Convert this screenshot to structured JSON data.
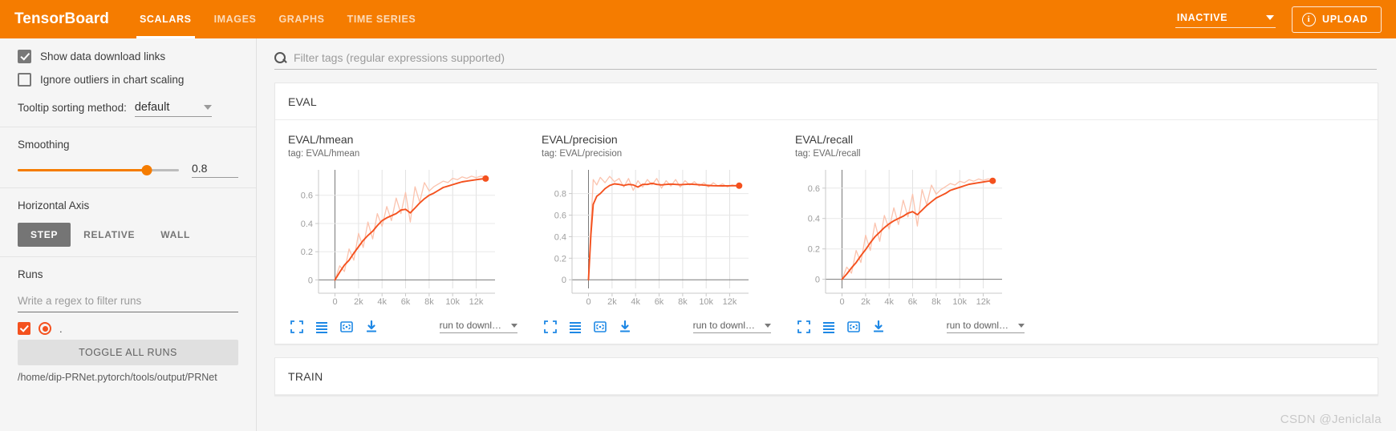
{
  "appbar": {
    "brand": "TensorBoard",
    "tabs": [
      {
        "label": "SCALARS",
        "active": true
      },
      {
        "label": "IMAGES",
        "active": false
      },
      {
        "label": "GRAPHS",
        "active": false
      },
      {
        "label": "TIME SERIES",
        "active": false
      }
    ],
    "run_status": "INACTIVE",
    "upload_label": "UPLOAD",
    "info_glyph": "i",
    "bar_color": "#f57c00"
  },
  "sidebar": {
    "show_download_links": {
      "label": "Show data download links",
      "checked": true
    },
    "ignore_outliers": {
      "label": "Ignore outliers in chart scaling",
      "checked": false
    },
    "tooltip_sorting": {
      "label": "Tooltip sorting method:",
      "value": "default"
    },
    "smoothing": {
      "title": "Smoothing",
      "value": "0.8",
      "percent": 80
    },
    "horizontal_axis": {
      "title": "Horizontal Axis",
      "options": [
        "STEP",
        "RELATIVE",
        "WALL"
      ],
      "selected": "STEP"
    },
    "runs": {
      "title": "Runs",
      "filter_placeholder": "Write a regex to filter runs",
      "run_label": ".",
      "toggle_all_label": "TOGGLE ALL RUNS",
      "path": "/home/dip-PRNet.pytorch/tools/output/PRNet"
    },
    "accent_color": "#f4511e"
  },
  "main": {
    "filter_placeholder": "Filter tags (regular expressions supported)",
    "sections": [
      {
        "title": "EVAL"
      },
      {
        "title": "TRAIN"
      }
    ],
    "download_select_label": "run to downl…",
    "toolbar_icons": [
      "expand-icon",
      "lines-icon",
      "fit-icon",
      "download-icon"
    ],
    "watermark": "CSDN @Jeniclala"
  },
  "chart_data": [
    {
      "type": "line",
      "title": "EVAL/hmean",
      "tag": "tag: EVAL/hmean",
      "xlabel": "",
      "ylabel": "",
      "xlim": [
        -1400,
        13600
      ],
      "ylim": [
        -0.06,
        0.78
      ],
      "xticks": [
        "0",
        "2k",
        "4k",
        "6k",
        "8k",
        "10k",
        "12k"
      ],
      "xtick_values": [
        0,
        2000,
        4000,
        6000,
        8000,
        10000,
        12000
      ],
      "yticks": [
        "0",
        "0.2",
        "0.4",
        "0.6"
      ],
      "ytick_values": [
        0,
        0.2,
        0.4,
        0.6
      ],
      "grid": true,
      "series": [
        {
          "name": "smoothed",
          "color": "#f4511e",
          "x": [
            0,
            400,
            800,
            1200,
            1600,
            2000,
            2400,
            2800,
            3200,
            3600,
            4000,
            4400,
            4800,
            5200,
            5600,
            6000,
            6400,
            6800,
            7200,
            7600,
            8000,
            8400,
            8800,
            9200,
            9600,
            10000,
            10400,
            10800,
            11200,
            11600,
            12000,
            12400,
            12800
          ],
          "values": [
            0.0,
            0.055,
            0.105,
            0.14,
            0.19,
            0.235,
            0.28,
            0.315,
            0.345,
            0.385,
            0.42,
            0.44,
            0.455,
            0.47,
            0.495,
            0.5,
            0.475,
            0.51,
            0.545,
            0.575,
            0.6,
            0.615,
            0.635,
            0.655,
            0.665,
            0.675,
            0.685,
            0.695,
            0.7,
            0.705,
            0.71,
            0.715,
            0.718
          ]
        },
        {
          "name": "raw",
          "color": "#fbc3ae",
          "x": [
            0,
            400,
            800,
            1200,
            1600,
            2000,
            2400,
            2800,
            3200,
            3600,
            4000,
            4400,
            4800,
            5200,
            5600,
            6000,
            6400,
            6800,
            7200,
            7600,
            8000,
            8400,
            8800,
            9200,
            9600,
            10000,
            10400,
            10800,
            11200,
            11600,
            12000,
            12400,
            12800
          ],
          "values": [
            0.0,
            0.1,
            0.06,
            0.22,
            0.14,
            0.33,
            0.23,
            0.41,
            0.29,
            0.47,
            0.38,
            0.52,
            0.42,
            0.58,
            0.47,
            0.62,
            0.41,
            0.66,
            0.55,
            0.69,
            0.63,
            0.66,
            0.68,
            0.7,
            0.69,
            0.72,
            0.71,
            0.73,
            0.72,
            0.735,
            0.725,
            0.735,
            0.73
          ]
        }
      ],
      "endpoint": {
        "x": 12800,
        "y": 0.718
      }
    },
    {
      "type": "line",
      "title": "EVAL/precision",
      "tag": "tag: EVAL/precision",
      "xlabel": "",
      "ylabel": "",
      "xlim": [
        -1400,
        13600
      ],
      "ylim": [
        -0.08,
        1.02
      ],
      "xticks": [
        "0",
        "2k",
        "4k",
        "6k",
        "8k",
        "10k",
        "12k"
      ],
      "xtick_values": [
        0,
        2000,
        4000,
        6000,
        8000,
        10000,
        12000
      ],
      "yticks": [
        "0",
        "0.2",
        "0.4",
        "0.6",
        "0.8"
      ],
      "ytick_values": [
        0,
        0.2,
        0.4,
        0.6,
        0.8
      ],
      "grid": true,
      "series": [
        {
          "name": "smoothed",
          "color": "#f4511e",
          "x": [
            0,
            200,
            400,
            700,
            1000,
            1400,
            1800,
            2200,
            2600,
            3000,
            3400,
            3800,
            4200,
            4600,
            5000,
            5400,
            5800,
            6200,
            6600,
            7000,
            7400,
            7800,
            8200,
            8600,
            9000,
            9400,
            9800,
            10200,
            10600,
            11000,
            11400,
            11800,
            12200,
            12600,
            12800
          ],
          "values": [
            0.0,
            0.42,
            0.7,
            0.775,
            0.8,
            0.845,
            0.875,
            0.89,
            0.885,
            0.875,
            0.885,
            0.88,
            0.86,
            0.885,
            0.885,
            0.895,
            0.885,
            0.88,
            0.885,
            0.888,
            0.885,
            0.882,
            0.885,
            0.888,
            0.885,
            0.882,
            0.878,
            0.875,
            0.873,
            0.872,
            0.871,
            0.872,
            0.873,
            0.873,
            0.873
          ]
        },
        {
          "name": "raw",
          "color": "#fbc3ae",
          "x": [
            0,
            200,
            400,
            700,
            1000,
            1400,
            1800,
            2200,
            2600,
            3000,
            3400,
            3800,
            4200,
            4600,
            5000,
            5400,
            5800,
            6200,
            6600,
            7000,
            7400,
            7800,
            8200,
            8600,
            9000,
            9400,
            9800,
            10200,
            10600,
            11000,
            11400,
            11800,
            12200,
            12600,
            12800
          ],
          "values": [
            0.0,
            0.5,
            0.93,
            0.88,
            0.95,
            0.9,
            0.96,
            0.91,
            0.94,
            0.86,
            0.94,
            0.83,
            0.92,
            0.86,
            0.93,
            0.88,
            0.94,
            0.85,
            0.92,
            0.87,
            0.93,
            0.86,
            0.92,
            0.88,
            0.91,
            0.87,
            0.9,
            0.86,
            0.9,
            0.87,
            0.89,
            0.86,
            0.88,
            0.87,
            0.875
          ]
        }
      ],
      "endpoint": {
        "x": 12800,
        "y": 0.873
      }
    },
    {
      "type": "line",
      "title": "EVAL/recall",
      "tag": "tag: EVAL/recall",
      "xlabel": "",
      "ylabel": "",
      "xlim": [
        -1400,
        13600
      ],
      "ylim": [
        -0.06,
        0.72
      ],
      "xticks": [
        "0",
        "2k",
        "4k",
        "6k",
        "8k",
        "10k",
        "12k"
      ],
      "xtick_values": [
        0,
        2000,
        4000,
        6000,
        8000,
        10000,
        12000
      ],
      "yticks": [
        "0",
        "0.2",
        "0.4",
        "0.6"
      ],
      "ytick_values": [
        0,
        0.2,
        0.4,
        0.6
      ],
      "grid": true,
      "series": [
        {
          "name": "smoothed",
          "color": "#f4511e",
          "x": [
            0,
            400,
            800,
            1200,
            1600,
            2000,
            2400,
            2800,
            3200,
            3600,
            4000,
            4400,
            4800,
            5200,
            5600,
            6000,
            6400,
            6800,
            7200,
            7600,
            8000,
            8400,
            8800,
            9200,
            9600,
            10000,
            10400,
            10800,
            11200,
            11600,
            12000,
            12400,
            12800
          ],
          "values": [
            0.0,
            0.035,
            0.075,
            0.11,
            0.155,
            0.195,
            0.24,
            0.28,
            0.31,
            0.34,
            0.365,
            0.385,
            0.4,
            0.415,
            0.435,
            0.445,
            0.425,
            0.455,
            0.485,
            0.51,
            0.535,
            0.55,
            0.565,
            0.585,
            0.595,
            0.605,
            0.615,
            0.625,
            0.63,
            0.635,
            0.64,
            0.645,
            0.648
          ]
        },
        {
          "name": "raw",
          "color": "#fbc3ae",
          "x": [
            0,
            400,
            800,
            1200,
            1600,
            2000,
            2400,
            2800,
            3200,
            3600,
            4000,
            4400,
            4800,
            5200,
            5600,
            6000,
            6400,
            6800,
            7200,
            7600,
            8000,
            8400,
            8800,
            9200,
            9600,
            10000,
            10400,
            10800,
            11200,
            11600,
            12000,
            12400,
            12800
          ],
          "values": [
            0.0,
            0.08,
            0.04,
            0.19,
            0.11,
            0.29,
            0.19,
            0.37,
            0.25,
            0.42,
            0.33,
            0.47,
            0.36,
            0.52,
            0.41,
            0.56,
            0.35,
            0.59,
            0.49,
            0.62,
            0.56,
            0.59,
            0.61,
            0.63,
            0.62,
            0.645,
            0.635,
            0.655,
            0.645,
            0.66,
            0.65,
            0.66,
            0.655
          ]
        }
      ],
      "endpoint": {
        "x": 12800,
        "y": 0.648
      }
    }
  ]
}
